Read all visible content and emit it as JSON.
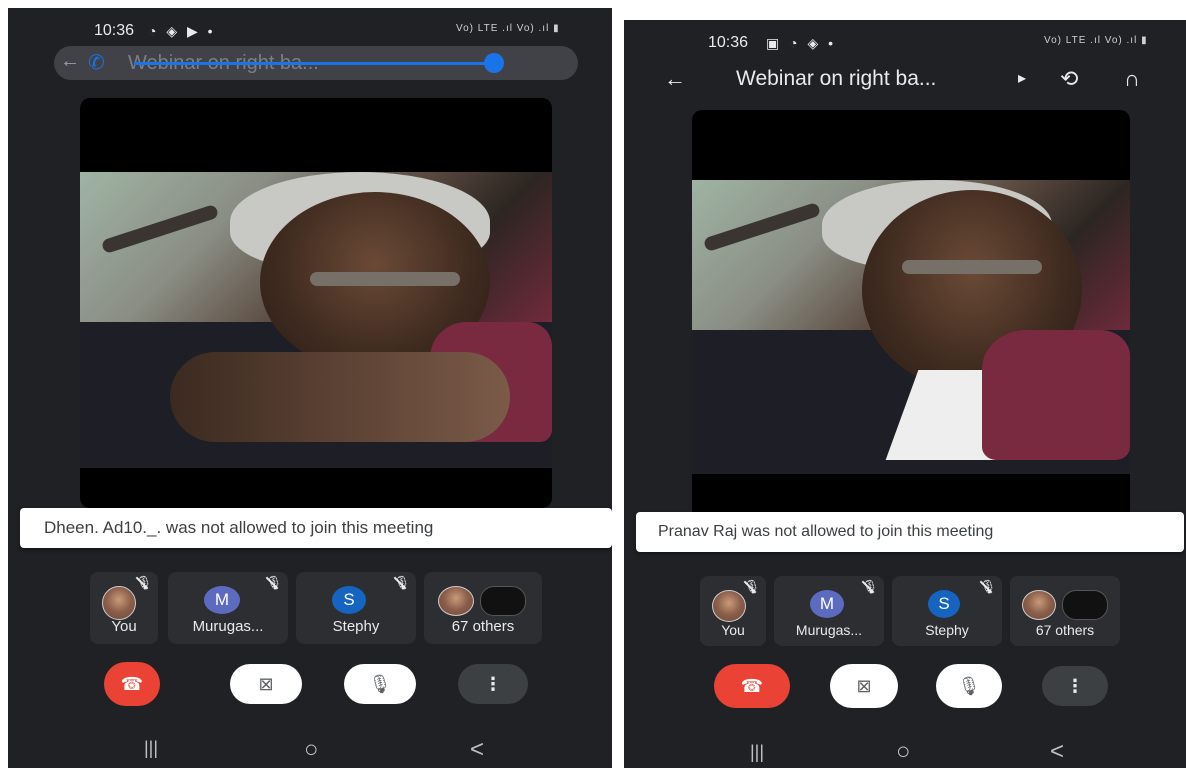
{
  "left": {
    "status_time": "10:36",
    "status_icons": "◔ ◈ ▶ •",
    "status_signal": "Vo) LTE .ıl Vo) .ıl ▮",
    "title": "Webinar on right ba...",
    "toast": "Dheen. Ad10._. was not allowed to join this meeting",
    "participants": [
      {
        "label": "You",
        "avatar": ""
      },
      {
        "label": "Murugas...",
        "avatar": "M",
        "color": "#5c6bc0"
      },
      {
        "label": "Stephy",
        "avatar": "S",
        "color": "#1565c0"
      },
      {
        "label": "67 others",
        "avatar": ""
      }
    ]
  },
  "right": {
    "status_time": "10:36",
    "status_icons": "▣ ◔ ◈ •",
    "status_signal": "Vo) LTE .ıl Vo) .ıl ▮",
    "title": "Webinar on right ba...",
    "toast": "Pranav Raj was not allowed to join this meeting",
    "participants": [
      {
        "label": "You",
        "avatar": ""
      },
      {
        "label": "Murugas...",
        "avatar": "M",
        "color": "#5c6bc0"
      },
      {
        "label": "Stephy",
        "avatar": "S",
        "color": "#1565c0"
      },
      {
        "label": "67 others",
        "avatar": ""
      }
    ]
  },
  "glyphs": {
    "back": "←",
    "back_chevron": "<",
    "phone": "✆",
    "dropdown": "▸",
    "camera_switch": "⟲",
    "headphones": "∩",
    "end_call": "☎",
    "video_off": "⊠",
    "mic_off": "🎙",
    "more": "⋮",
    "nav_recent": "|||",
    "nav_home": "○",
    "nav_back": "<"
  },
  "icons": [
    "phone-icon",
    "camera-switch-icon",
    "headphones-icon",
    "end-call-icon",
    "video-off-icon",
    "mic-off-icon",
    "more-icon"
  ]
}
